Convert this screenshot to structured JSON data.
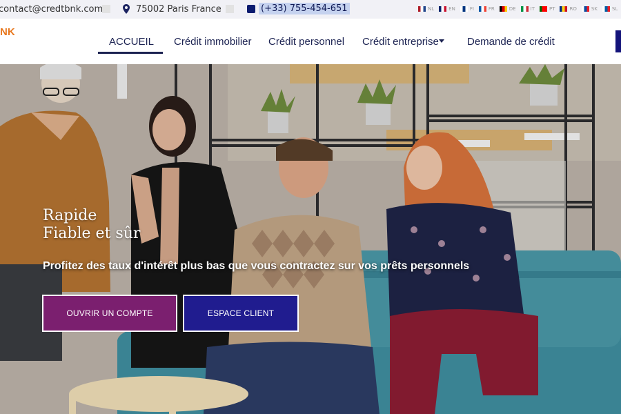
{
  "topbar": {
    "email": "contact@credtbnk.com",
    "address": "75002 Paris France",
    "phone": "(+33) 755-454-651",
    "languages": [
      {
        "code": "NL",
        "colors": [
          "#ae1c28",
          "#ffffff",
          "#21468b"
        ]
      },
      {
        "code": "EN",
        "colors": [
          "#012169",
          "#ffffff",
          "#c8102e"
        ]
      },
      {
        "code": "FI",
        "colors": [
          "#ffffff",
          "#003580",
          "#ffffff"
        ]
      },
      {
        "code": "FR",
        "colors": [
          "#0055a4",
          "#ffffff",
          "#ef4135"
        ]
      },
      {
        "code": "DE",
        "colors": [
          "#000000",
          "#dd0000",
          "#ffce00"
        ]
      },
      {
        "code": "IT",
        "colors": [
          "#009246",
          "#ffffff",
          "#ce2b37"
        ]
      },
      {
        "code": "PT",
        "colors": [
          "#006600",
          "#ff0000",
          "#ff0000"
        ]
      },
      {
        "code": "RO",
        "colors": [
          "#002b7f",
          "#fcd116",
          "#ce1126"
        ]
      },
      {
        "code": "SK",
        "colors": [
          "#ffffff",
          "#0b4ea2",
          "#ee1c25"
        ]
      },
      {
        "code": "SL",
        "colors": [
          "#ffffff",
          "#005da4",
          "#ed1c24"
        ]
      }
    ]
  },
  "logo": "NK",
  "nav": {
    "items": [
      "ACCUEIL",
      "Crédit immobilier",
      "Crédit personnel",
      "Crédit entreprise",
      "Demande de crédit"
    ]
  },
  "hero": {
    "tagline_1": "Rapide",
    "tagline_2": "Fiable et sûr",
    "subtitle": "Profitez des taux d'intérêt plus bas que vous contractez sur vos prêts personnels",
    "btn_open": "OUVRIR UN COMPTE",
    "btn_client": "ESPACE CLIENT"
  },
  "colors": {
    "accent": "#e8781f",
    "nav_text": "#1c2352",
    "btn_open_bg": "#7b1f6f",
    "btn_client_bg": "#201c8f"
  }
}
